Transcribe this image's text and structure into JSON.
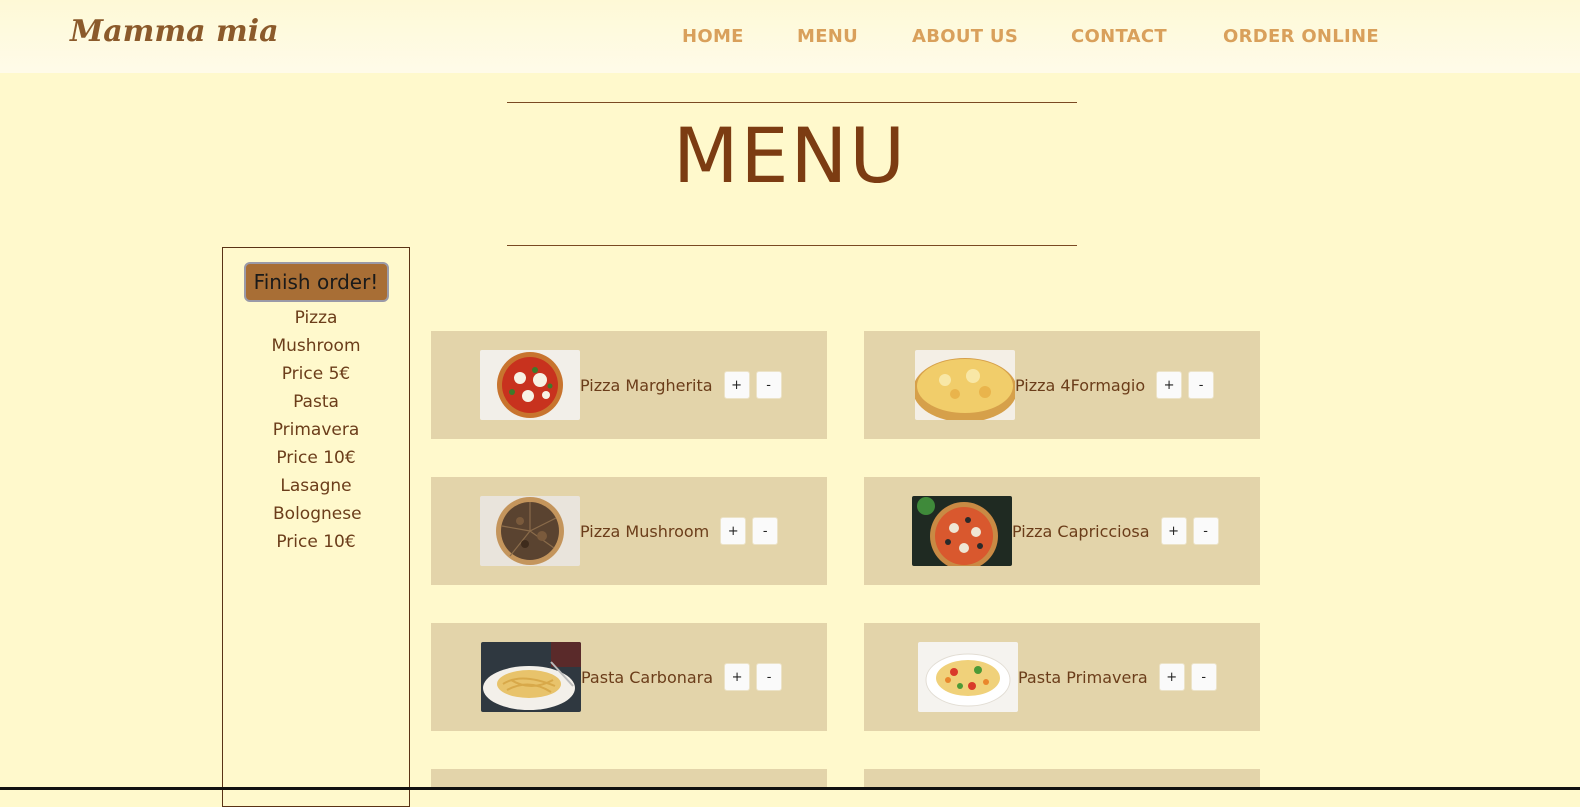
{
  "brand": {
    "name": "Mamma mia"
  },
  "nav": {
    "items": [
      {
        "label": "HOME"
      },
      {
        "label": "MENU"
      },
      {
        "label": "ABOUT US"
      },
      {
        "label": "CONTACT"
      },
      {
        "label": "ORDER ONLINE"
      }
    ]
  },
  "page": {
    "title": "MENU"
  },
  "order": {
    "finish_label": "Finish order!",
    "items": [
      {
        "name": "Pizza Mushroom",
        "price": "Price 5€"
      },
      {
        "name": "Pasta Primavera",
        "price": "Price 10€"
      },
      {
        "name": "Lasagne Bolognese",
        "price": "Price 10€"
      }
    ]
  },
  "menu": {
    "plus_label": "+",
    "minus_label": "-",
    "items": [
      {
        "name": "Pizza Margherita",
        "image": "pizza-margherita-photo"
      },
      {
        "name": "Pizza 4Formagio",
        "image": "pizza-4formagio-photo"
      },
      {
        "name": "Pizza Mushroom",
        "image": "pizza-mushroom-photo"
      },
      {
        "name": "Pizza Capricciosa",
        "image": "pizza-capricciosa-photo"
      },
      {
        "name": "Pasta Carbonara",
        "image": "pasta-carbonara-photo"
      },
      {
        "name": "Pasta Primavera",
        "image": "pasta-primavera-photo"
      }
    ]
  },
  "colors": {
    "background": "#fff9cc",
    "card": "#e3d4aa",
    "accent": "#a86e35",
    "nav_link": "#d9a05b",
    "title": "#7c3c12"
  }
}
